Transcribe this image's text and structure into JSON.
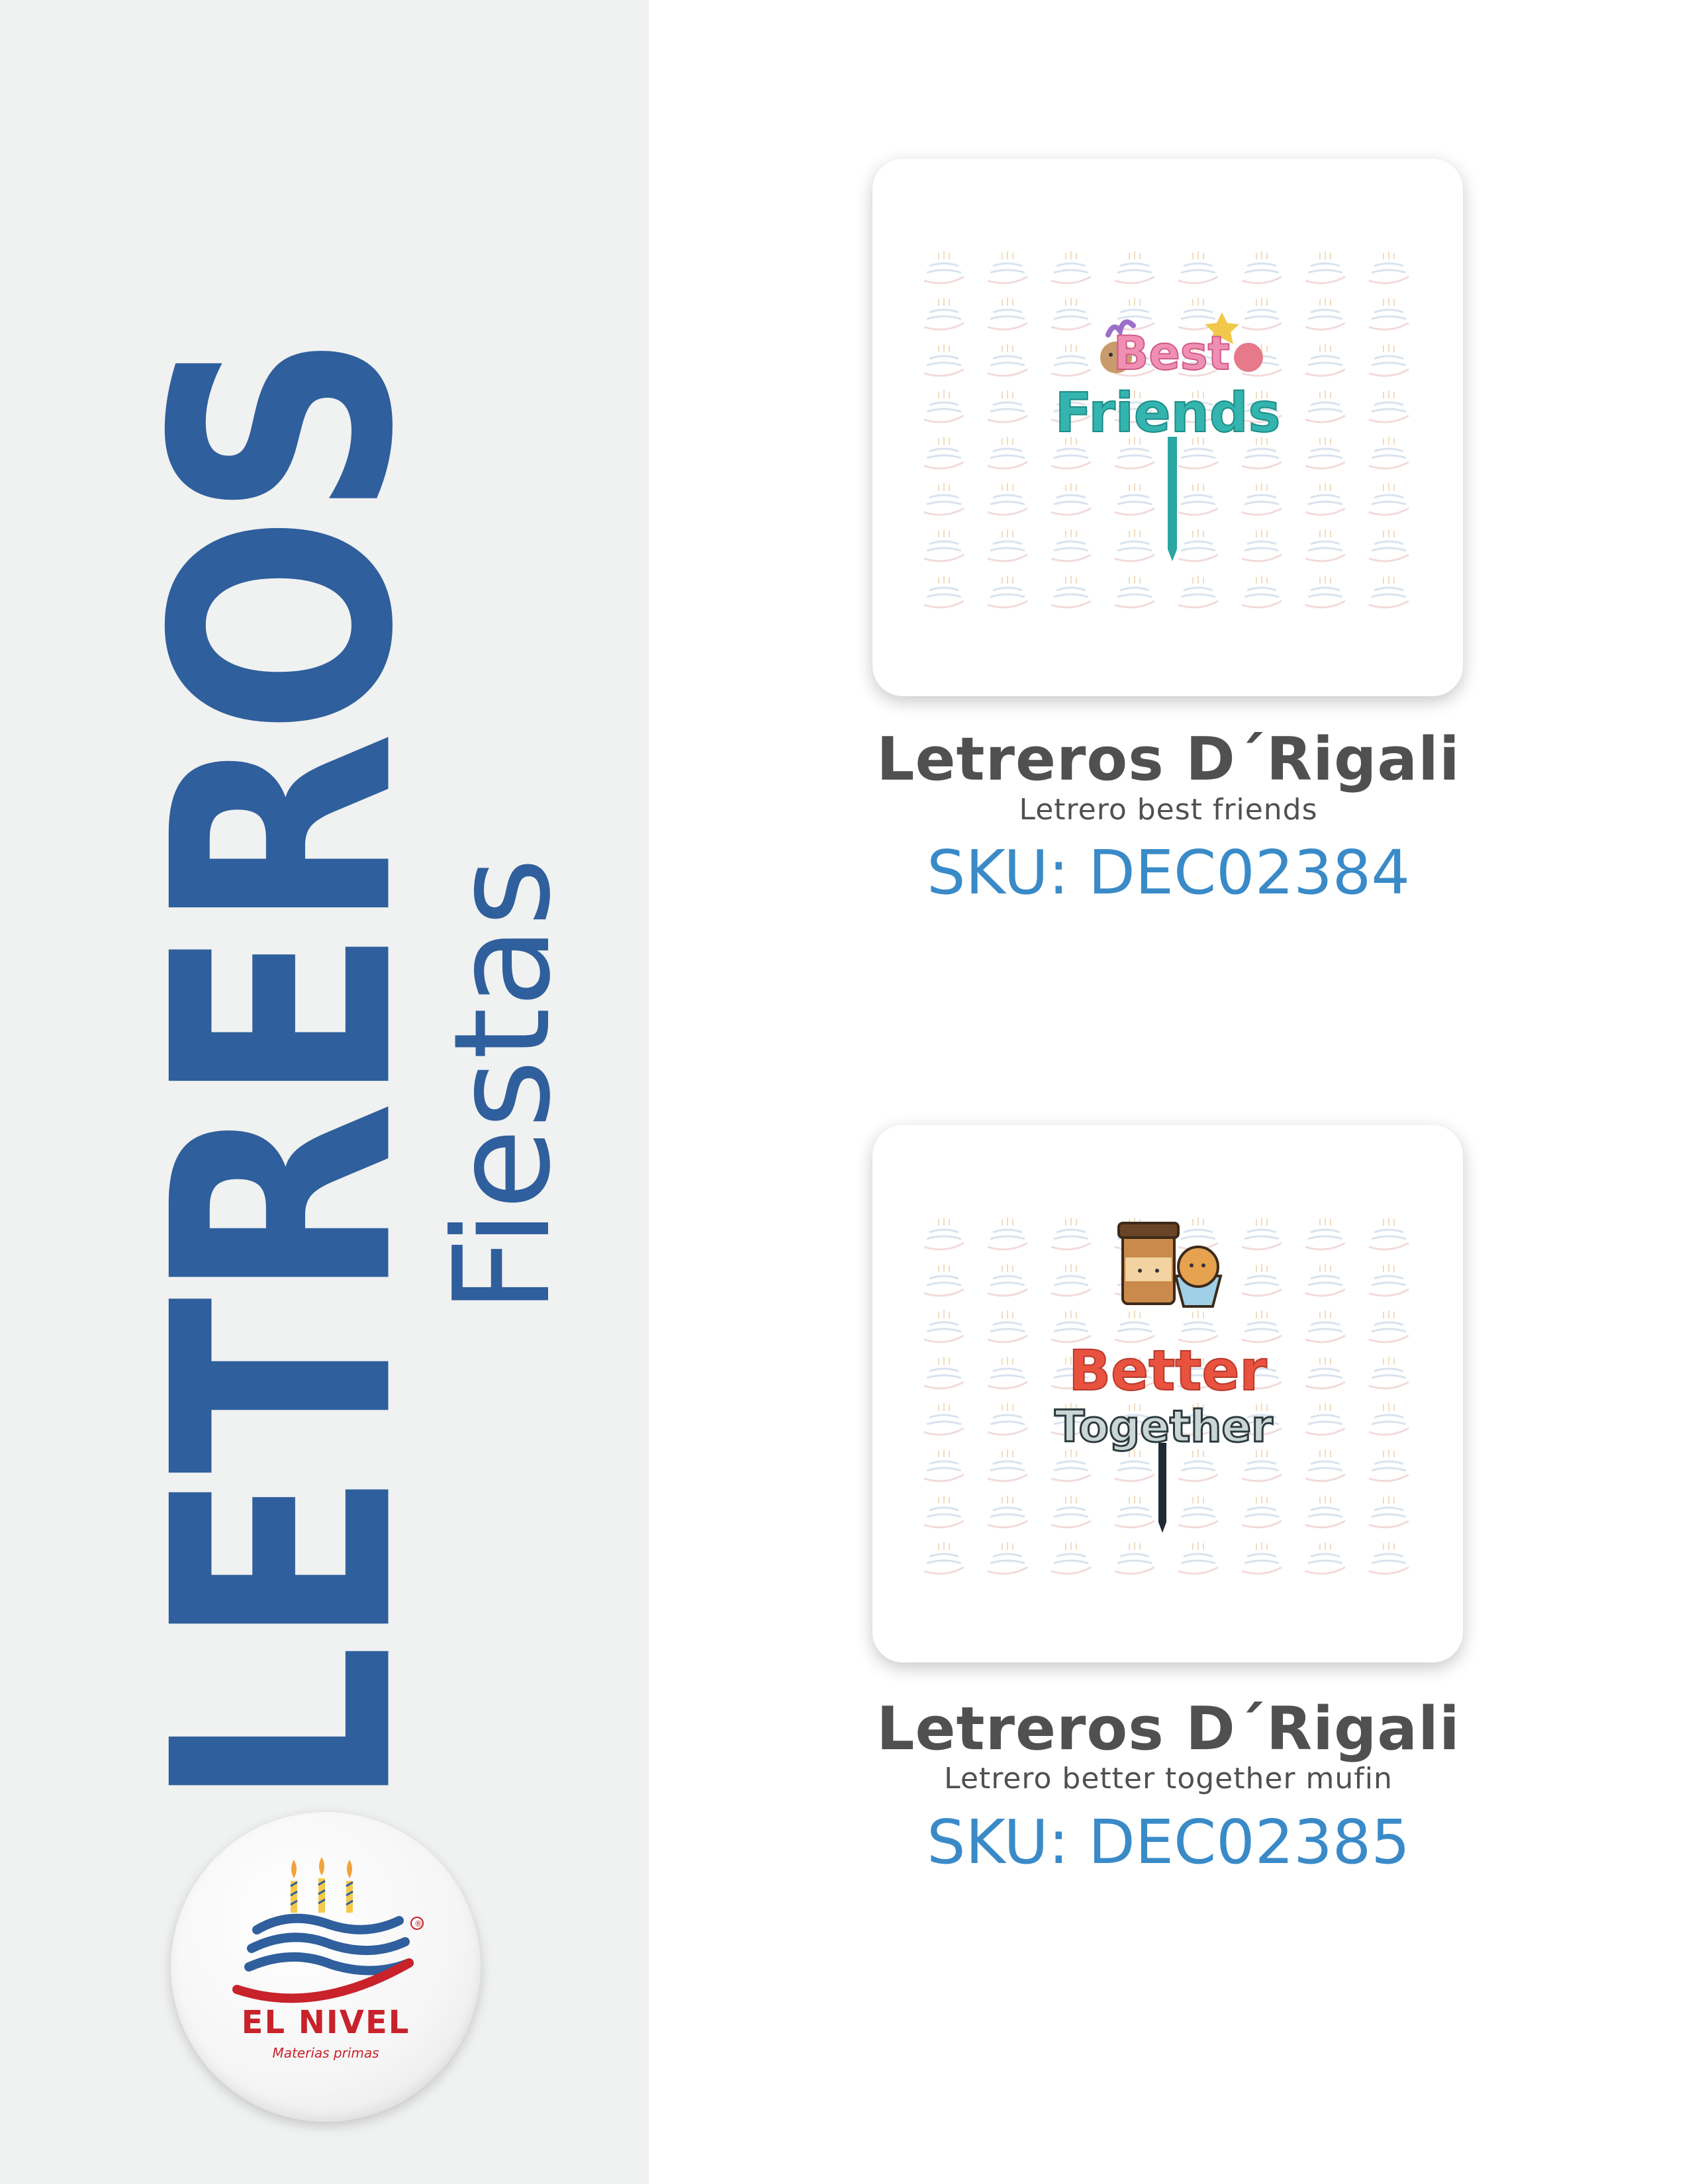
{
  "sidebar": {
    "title": "LETREROS",
    "subtitle": "Fiestas",
    "logo": {
      "name": "EL NIVEL",
      "tagline": "Materias primas",
      "mark": "®"
    }
  },
  "products": [
    {
      "name": "Letreros D´Rigali",
      "description": "Letrero best friends",
      "sku": "SKU: DEC02384",
      "image": {
        "line1": "Best",
        "line2": "Friends"
      }
    },
    {
      "name": "Letreros D´Rigali",
      "description": "Letrero better together mufin",
      "sku": "SKU: DEC02385",
      "image": {
        "line1": "Better",
        "line2": "Together"
      }
    }
  ],
  "colors": {
    "brand_blue": "#2f5f9c",
    "sku_blue": "#3a8ac8",
    "text_gray": "#505050",
    "logo_red": "#c8222b",
    "sidebar_bg": "#f0f1f1"
  }
}
